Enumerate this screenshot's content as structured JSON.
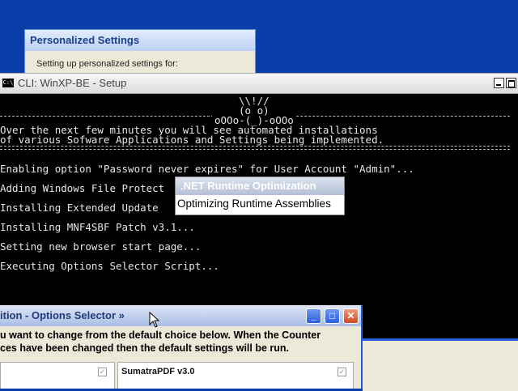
{
  "personalized_settings": {
    "title": "Personalized Settings",
    "text": "Setting up personalized settings for:"
  },
  "cli": {
    "title": "CLI: WinXP-BE - Setup",
    "icon": "console-icon",
    "owl_line1": "\\\\!//",
    "owl_line2": "(o o)",
    "owl_feet": "oOOo-(_)-oOOo",
    "intro_line1": "Over the next few minutes you will see automated installations",
    "intro_line2": "of various Sofware Applications and Settings being implemented.",
    "lines": [
      "Enabling option \"Password never expires\" for User Account \"Admin\"...",
      "Adding Windows File Protect",
      "Installing Extended Update",
      "Installing MNF4SBF Patch v3.1...",
      "Setting new browser start page...",
      "Executing Options Selector Script..."
    ]
  },
  "net_popup": {
    "title": ".NET Runtime Optimization",
    "body": "Optimizing Runtime Assemblies"
  },
  "options_selector": {
    "title": "ition - Options Selector »",
    "desc_line1": "u want to change from the default choice below. When the Counter",
    "desc_line2": "ces have been changed then the default settings will be run.",
    "list_b_item": "SumatraPDF v3.0"
  },
  "colors": {
    "desktop": "#0a3ea8",
    "console_bg": "#000000",
    "console_text": "#e6e6e6",
    "xp_blue": "#2a5bd7"
  }
}
